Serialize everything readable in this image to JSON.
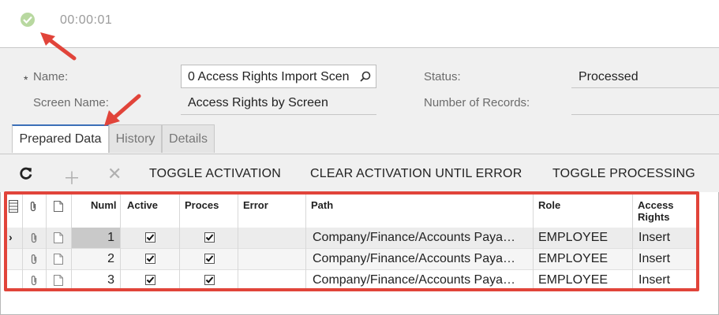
{
  "status_strip": {
    "timer": "00:00:01",
    "status_icon": "check-circle-icon"
  },
  "form": {
    "name_label": "Name:",
    "name_required_mark": "*",
    "name_value": "0 Access Rights Import Scen",
    "screen_name_label": "Screen Name:",
    "screen_name_value": "Access Rights by Screen",
    "status_label": "Status:",
    "status_value": "Processed",
    "records_label": "Number of Records:",
    "records_value": ""
  },
  "tabs": [
    {
      "label": "Prepared Data",
      "active": true
    },
    {
      "label": "History",
      "active": false
    },
    {
      "label": "Details",
      "active": false
    }
  ],
  "toolbar": {
    "toggle_activation": "TOGGLE ACTIVATION",
    "clear_activation": "CLEAR ACTIVATION UNTIL ERROR",
    "toggle_processing": "TOGGLE PROCESSING"
  },
  "grid": {
    "columns": [
      "Numl",
      "Active",
      "Proces",
      "Error",
      "Path",
      "Role",
      "Access Rights"
    ],
    "rows": [
      {
        "num": "1",
        "active": true,
        "processed": true,
        "error": "",
        "path": "Company/Finance/Accounts Paya…",
        "role": "EMPLOYEE",
        "rights": "Insert"
      },
      {
        "num": "2",
        "active": true,
        "processed": true,
        "error": "",
        "path": "Company/Finance/Accounts Paya…",
        "role": "EMPLOYEE",
        "rights": "Insert"
      },
      {
        "num": "3",
        "active": true,
        "processed": true,
        "error": "",
        "path": "Company/Finance/Accounts Paya…",
        "role": "EMPLOYEE",
        "rights": "Insert"
      }
    ]
  },
  "colors": {
    "highlight": "#e1443a",
    "active_tab_accent": "#3b6fb8"
  }
}
